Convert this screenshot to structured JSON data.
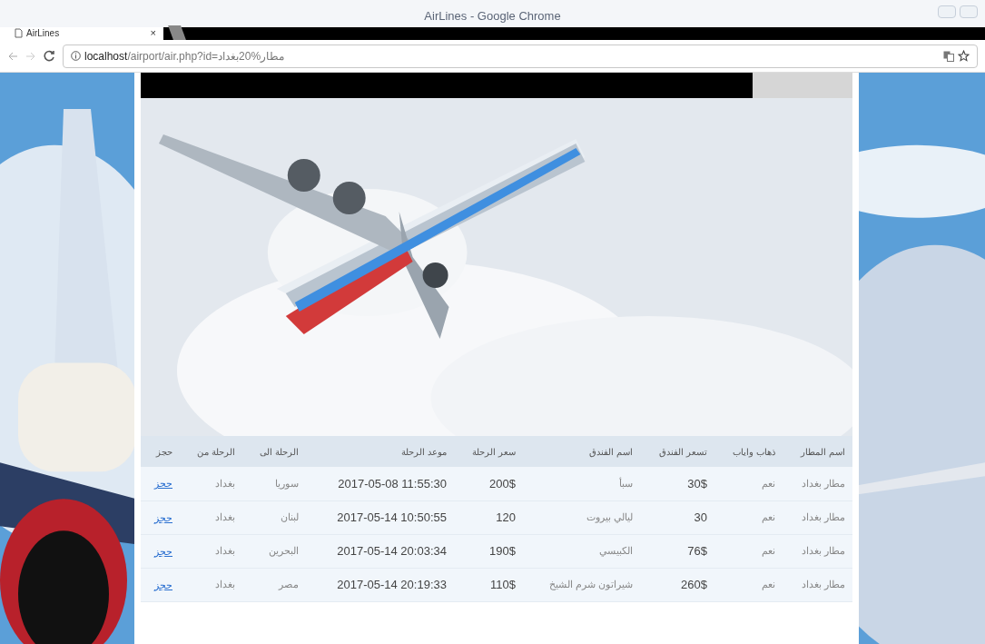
{
  "window": {
    "title": "AirLines - Google Chrome"
  },
  "tab": {
    "title": "AirLines",
    "close": "×"
  },
  "address_bar": {
    "host": "localhost",
    "path": "/airport/air.php?id=مطار%20بغداد"
  },
  "table": {
    "columns": [
      "اسم المطار",
      "ذهاب واياب",
      "تسعر الفندق",
      "اسم الفندق",
      "سعر الرحلة",
      "موعد الرحلة",
      "الرحلة الى",
      "الرحلة من",
      "حجز"
    ],
    "rows": [
      {
        "cells": [
          "مطار بغداد",
          "نعم",
          "30$",
          "سبأ",
          "200$",
          "2017-05-08 11:55:30",
          "سوريا",
          "بغداد"
        ],
        "link": "حجز"
      },
      {
        "cells": [
          "مطار بغداد",
          "نعم",
          "30",
          "ليالي بيروت",
          "120",
          "2017-05-14 10:50:55",
          "لبنان",
          "بغداد"
        ],
        "link": "حجز"
      },
      {
        "cells": [
          "مطار بغداد",
          "نعم",
          "76$",
          "الكبيسي",
          "190$",
          "2017-05-14 20:03:34",
          "البحرين",
          "بغداد"
        ],
        "link": "حجز"
      },
      {
        "cells": [
          "مطار بغداد",
          "نعم",
          "260$",
          "شيراتون شرم الشيخ",
          "110$",
          "2017-05-14 20:19:33",
          "مصر",
          "بغداد"
        ],
        "link": "حجز"
      }
    ]
  }
}
